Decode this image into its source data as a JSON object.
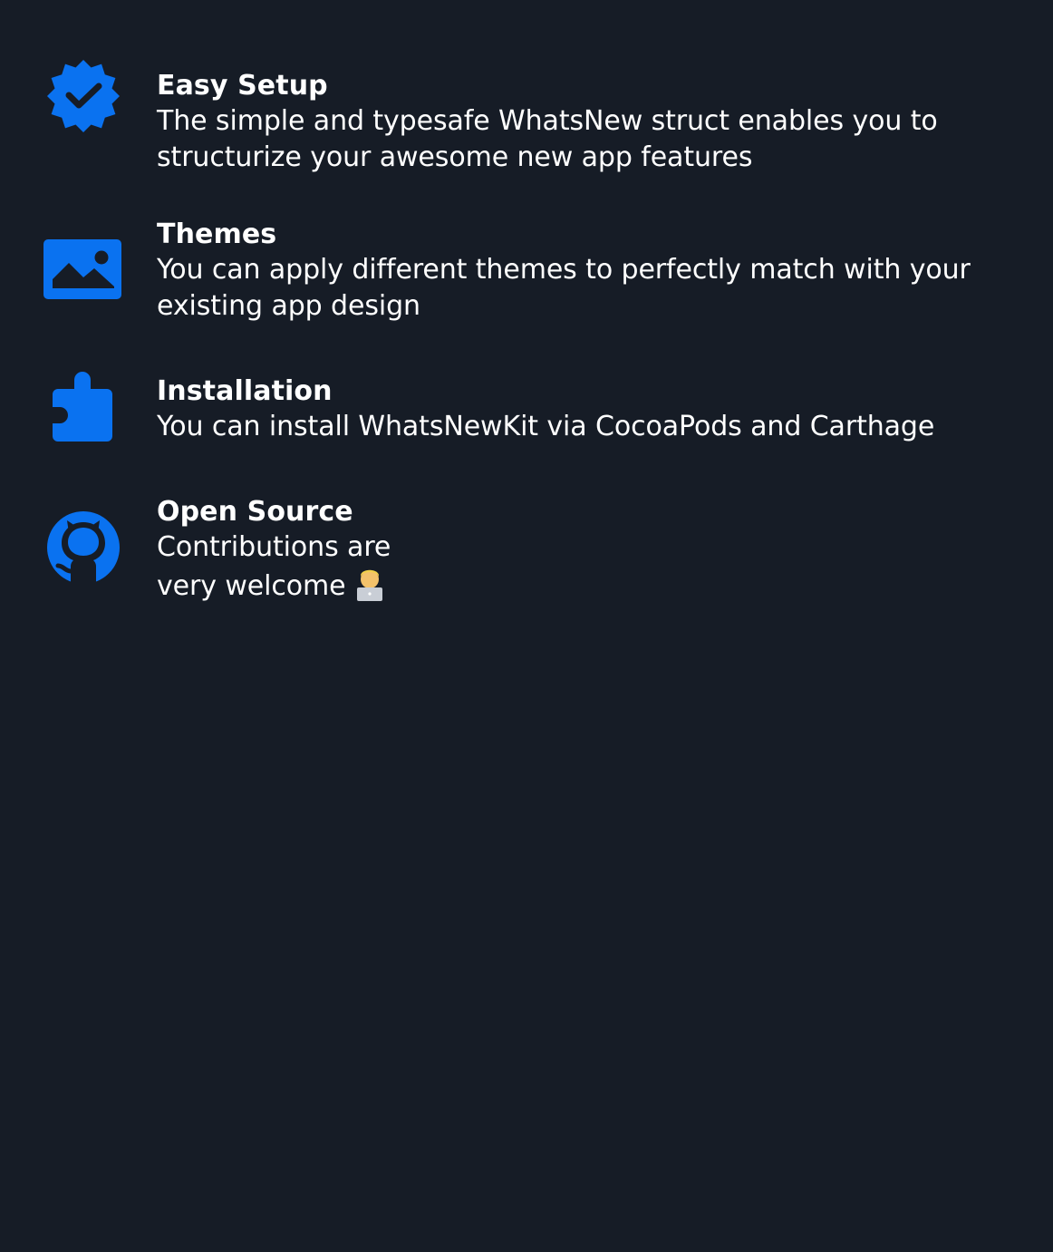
{
  "accent_color": "#0a72f0",
  "background_color": "#161c26",
  "features": [
    {
      "title": "Easy Setup",
      "subtitle": "The simple and typesafe WhatsNew struct enables you to structurize your awesome new app features",
      "icon": "verified-badge-icon"
    },
    {
      "title": "Themes",
      "subtitle": "You can apply different themes to perfectly match with your existing app design",
      "icon": "image-icon"
    },
    {
      "title": "Installation",
      "subtitle": "You can install WhatsNewKit via CocoaPods and Carthage",
      "icon": "puzzle-piece-icon"
    },
    {
      "title": "Open Source",
      "subtitle_line1": "Contributions are",
      "subtitle_line2": "very welcome",
      "emoji": "technologist-emoji",
      "icon": "github-icon"
    }
  ]
}
